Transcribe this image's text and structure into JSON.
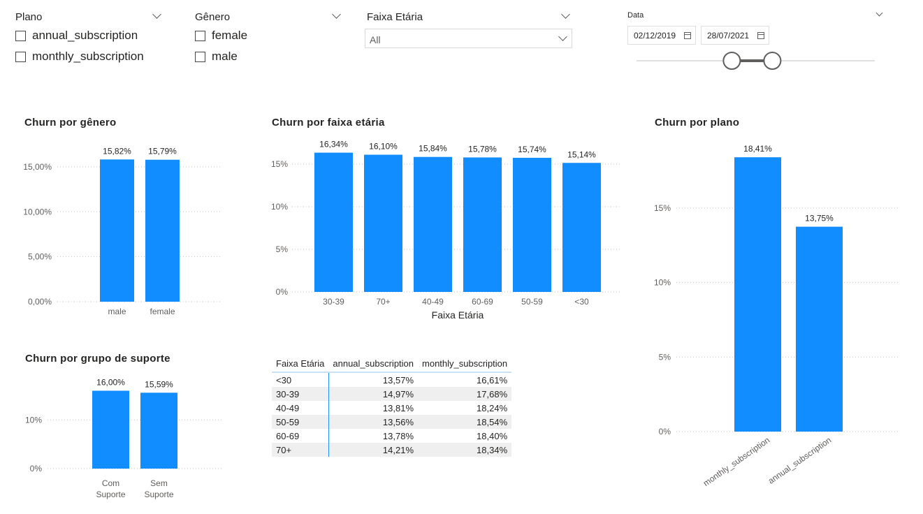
{
  "filters": {
    "plano": {
      "title": "Plano",
      "options": [
        "annual_subscription",
        "monthly_subscription"
      ]
    },
    "genero": {
      "title": "Gênero",
      "options": [
        "female",
        "male"
      ]
    },
    "faixa_etaria": {
      "title": "Faixa Etária",
      "selected": "All"
    },
    "data": {
      "title": "Data",
      "start": "02/12/2019",
      "end": "28/07/2021",
      "range_fraction": [
        0.4,
        0.57
      ]
    }
  },
  "colors": {
    "bar": "#118DFF",
    "accent": "#118DFF"
  },
  "chart_data": [
    {
      "id": "genero",
      "type": "bar",
      "title": "Churn por gênero",
      "categories": [
        "male",
        "female"
      ],
      "values": [
        15.82,
        15.79
      ],
      "data_labels": [
        "15,82%",
        "15,79%"
      ],
      "ylim": [
        0,
        16
      ],
      "yticks": [
        0,
        5,
        10,
        15
      ],
      "ytick_labels": [
        "0,00%",
        "5,00%",
        "10,00%",
        "15,00%"
      ],
      "xlabel": "",
      "ylabel": ""
    },
    {
      "id": "faixa",
      "type": "bar",
      "title": "Churn por faixa etária",
      "categories": [
        "30-39",
        "70+",
        "40-49",
        "60-69",
        "50-59",
        "<30"
      ],
      "values": [
        16.34,
        16.1,
        15.84,
        15.78,
        15.74,
        15.14
      ],
      "data_labels": [
        "16,34%",
        "16,10%",
        "15,84%",
        "15,78%",
        "15,74%",
        "15,14%"
      ],
      "ylim": [
        0,
        16.8
      ],
      "yticks": [
        0,
        5,
        10,
        15
      ],
      "ytick_labels": [
        "0%",
        "5%",
        "10%",
        "15%"
      ],
      "xlabel": "Faixa Etária",
      "ylabel": ""
    },
    {
      "id": "plano",
      "type": "bar",
      "title": "Churn por plano",
      "categories": [
        "monthly_subscription",
        "annual_subscription"
      ],
      "values": [
        18.41,
        13.75
      ],
      "data_labels": [
        "18,41%",
        "13,75%"
      ],
      "ylim": [
        0,
        18.7
      ],
      "yticks": [
        0,
        5,
        10,
        15
      ],
      "ytick_labels": [
        "0%",
        "5%",
        "10%",
        "15%"
      ],
      "xlabel": "",
      "ylabel": ""
    },
    {
      "id": "suporte",
      "type": "bar",
      "title": "Churn por grupo de suporte",
      "categories": [
        "Com Suporte",
        "Sem Suporte"
      ],
      "category_lines": [
        [
          "Com",
          "Suporte"
        ],
        [
          "Sem",
          "Suporte"
        ]
      ],
      "values": [
        16.0,
        15.59
      ],
      "data_labels": [
        "16,00%",
        "15,59%"
      ],
      "ylim": [
        0,
        16.5
      ],
      "yticks": [
        0,
        10
      ],
      "ytick_labels": [
        "0%",
        "10%"
      ],
      "xlabel": "",
      "ylabel": ""
    },
    {
      "id": "tabela",
      "type": "table",
      "columns": [
        "Faixa Etária",
        "annual_subscription",
        "monthly_subscription"
      ],
      "rows": [
        [
          "<30",
          "13,57%",
          "16,61%"
        ],
        [
          "30-39",
          "14,97%",
          "17,68%"
        ],
        [
          "40-49",
          "13,81%",
          "18,24%"
        ],
        [
          "50-59",
          "13,56%",
          "18,54%"
        ],
        [
          "60-69",
          "13,78%",
          "18,40%"
        ],
        [
          "70+",
          "14,21%",
          "18,34%"
        ]
      ]
    }
  ]
}
